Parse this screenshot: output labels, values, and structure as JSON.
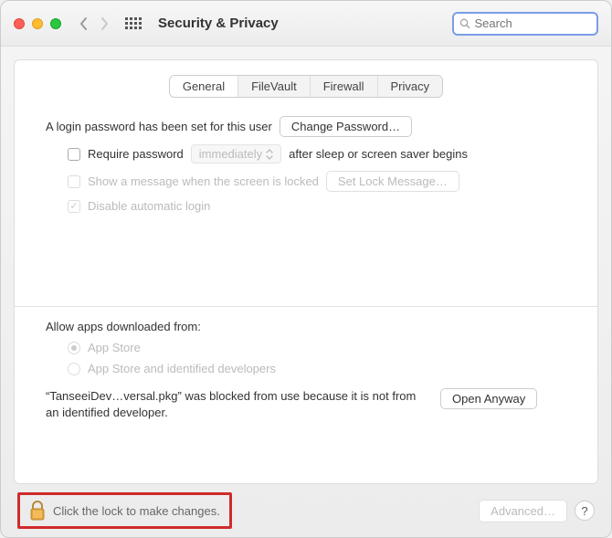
{
  "window": {
    "title": "Security & Privacy"
  },
  "search": {
    "placeholder": "Search"
  },
  "tabs": {
    "general": "General",
    "filevault": "FileVault",
    "firewall": "Firewall",
    "privacy": "Privacy"
  },
  "general": {
    "login_intro": "A login password has been set for this user",
    "change_password": "Change Password…",
    "require_password": "Require password",
    "require_delay": "immediately",
    "require_suffix": "after sleep or screen saver begins",
    "show_message": "Show a message when the screen is locked",
    "set_lock_message": "Set Lock Message…",
    "disable_auto_login": "Disable automatic login"
  },
  "downloads": {
    "heading": "Allow apps downloaded from:",
    "opt_store": "App Store",
    "opt_identified": "App Store and identified developers",
    "blocked_msg": "“TanseeiDev…versal.pkg” was blocked from use because it is not from an identified developer.",
    "open_anyway": "Open Anyway"
  },
  "footer": {
    "lock_hint": "Click the lock to make changes.",
    "advanced": "Advanced…",
    "help": "?"
  }
}
